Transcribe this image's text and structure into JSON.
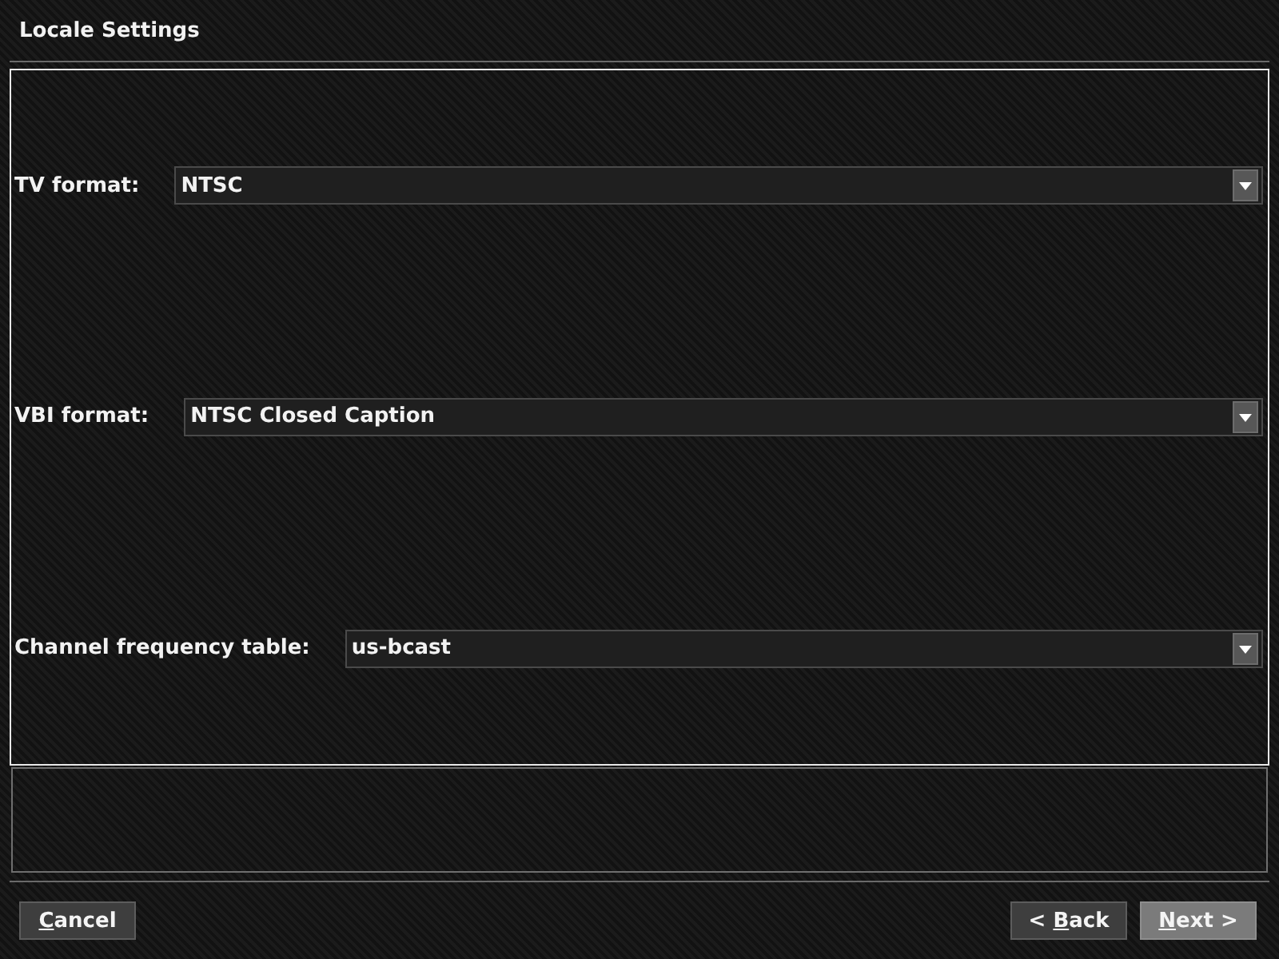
{
  "window": {
    "title": "Locale Settings"
  },
  "settings": [
    {
      "label": "TV format:",
      "value": "NTSC"
    },
    {
      "label": "VBI format:",
      "value": "NTSC Closed Caption"
    },
    {
      "label": "Channel frequency table:",
      "value": "us-bcast"
    }
  ],
  "footer": {
    "left_buttons": [
      {
        "label_parts": [
          {
            "text": "C",
            "underlined": true
          },
          {
            "text": "ancel",
            "underlined": false
          }
        ],
        "focused": false
      }
    ],
    "right_buttons": [
      {
        "label_parts": [
          {
            "text": "< ",
            "underlined": false
          },
          {
            "text": "B",
            "underlined": true
          },
          {
            "text": "ack",
            "underlined": false
          }
        ],
        "focused": false
      },
      {
        "label_parts": [
          {
            "text": "N",
            "underlined": true
          },
          {
            "text": "ext >",
            "underlined": false
          }
        ],
        "focused": true
      }
    ]
  }
}
